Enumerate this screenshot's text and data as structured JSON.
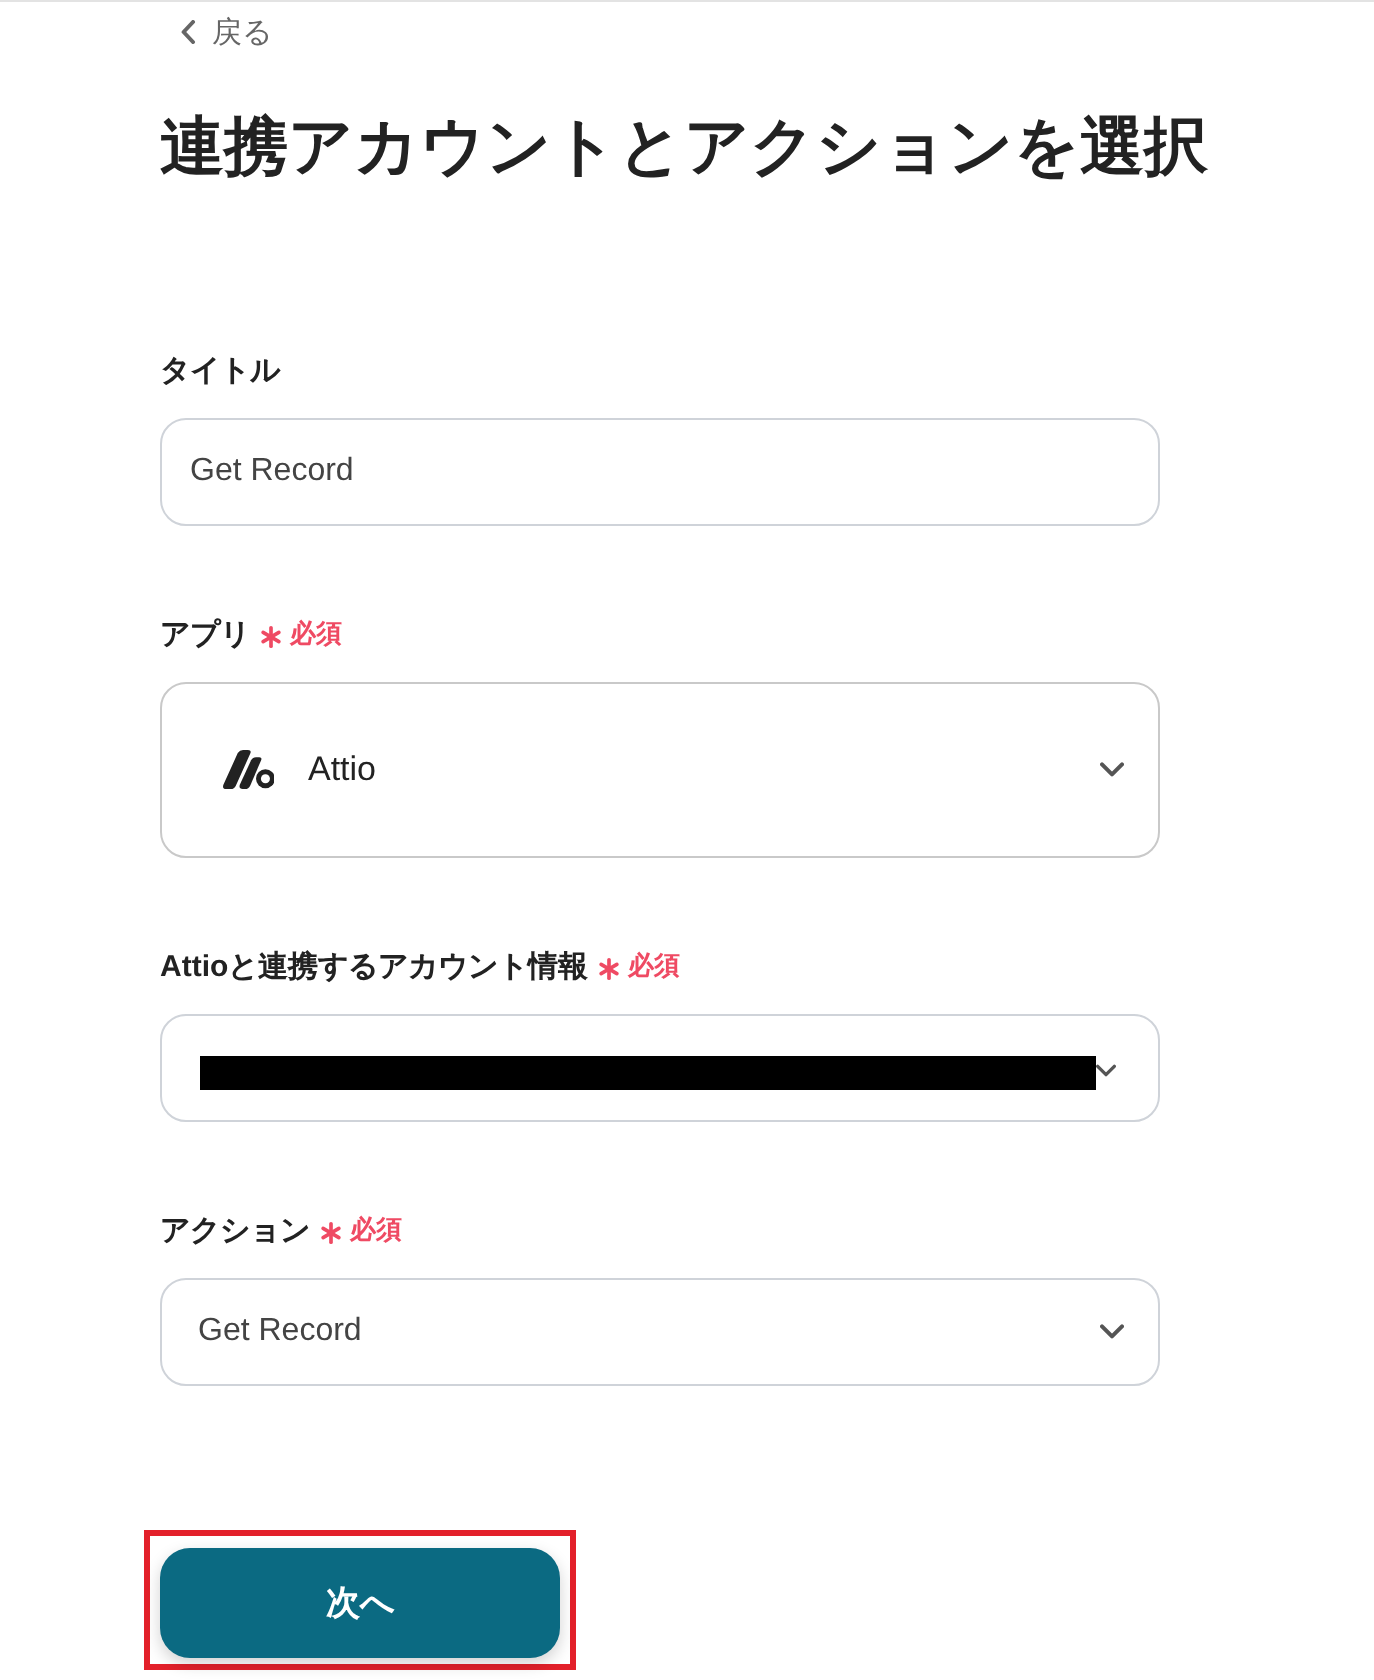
{
  "back_link": {
    "label": "戻る"
  },
  "title": "連携アカウントとアクションを選択",
  "fields": [
    {
      "kind": "text",
      "label": "タイトル",
      "required": false,
      "value": "Get Record"
    },
    {
      "kind": "app-select",
      "label": "アプリ",
      "required": true,
      "required_text": "必須",
      "value": "Attio"
    },
    {
      "kind": "account-select",
      "label": "Attioと連携するアカウント情報",
      "required": true,
      "required_text": "必須",
      "redacted": true
    },
    {
      "kind": "select",
      "label": "アクション",
      "required": true,
      "required_text": "必須",
      "value": "Get Record"
    }
  ],
  "next_button": {
    "label": "次へ",
    "highlighted": true
  }
}
